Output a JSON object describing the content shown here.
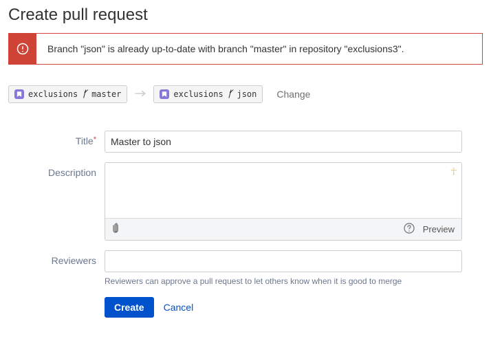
{
  "page": {
    "title": "Create pull request"
  },
  "alert": {
    "message": "Branch \"json\" is already up-to-date with branch \"master\" in repository \"exclusions3\"."
  },
  "branches": {
    "source": {
      "repo": "exclusions",
      "branch": "master"
    },
    "target": {
      "repo": "exclusions",
      "branch": "json"
    },
    "change_label": "Change"
  },
  "form": {
    "title_label": "Title",
    "title_value": "Master to json",
    "description_label": "Description",
    "description_value": "",
    "preview_label": "Preview",
    "reviewers_label": "Reviewers",
    "reviewers_value": "",
    "reviewers_hint": "Reviewers can approve a pull request to let others know when it is good to merge",
    "create_label": "Create",
    "cancel_label": "Cancel"
  }
}
